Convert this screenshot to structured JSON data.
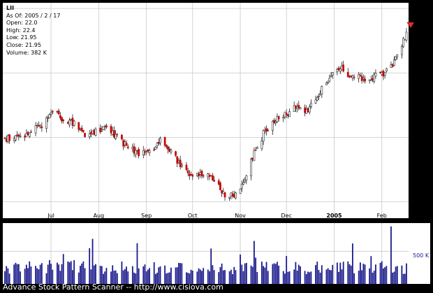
{
  "info": {
    "ticker": "LII",
    "as_of": "As Of: 2005 / 2 / 17",
    "open": "Open: 22.0",
    "high": "High: 22.4",
    "low": "Low: 21.95",
    "close": "Close: 21.95",
    "volume": "Volume: 382 K"
  },
  "caption": "Advance Stock Pattern Scanner -- http://www.cisiova.com",
  "colors": {
    "up": "#000000",
    "down": "#cc0000",
    "volume": "#1a1a8c",
    "grid": "#c8c8c8",
    "marker": "#e03030"
  },
  "chart_data": {
    "type": "candlestick",
    "title": "LII",
    "y_ticks": [
      "14",
      "17",
      "20",
      "23"
    ],
    "ylim": [
      13.3,
      23.2
    ],
    "x_ticks": [
      "Jul",
      "Aug",
      "Sep",
      "Oct",
      "Nov",
      "Dec",
      "2005",
      "Feb"
    ],
    "volume_label": "500 K",
    "anchors": [
      [
        "2004-06-01",
        16.9
      ],
      [
        "2004-06-10",
        17.0
      ],
      [
        "2004-06-18",
        17.2
      ],
      [
        "2004-06-25",
        17.6
      ],
      [
        "2004-07-01",
        18.3
      ],
      [
        "2004-07-08",
        17.9
      ],
      [
        "2004-07-16",
        17.6
      ],
      [
        "2004-07-23",
        17.2
      ],
      [
        "2004-07-30",
        17.3
      ],
      [
        "2004-08-06",
        17.6
      ],
      [
        "2004-08-13",
        17.0
      ],
      [
        "2004-08-20",
        16.5
      ],
      [
        "2004-08-27",
        16.2
      ],
      [
        "2004-09-03",
        16.3
      ],
      [
        "2004-09-10",
        16.8
      ],
      [
        "2004-09-17",
        16.3
      ],
      [
        "2004-09-24",
        15.6
      ],
      [
        "2004-10-01",
        15.1
      ],
      [
        "2004-10-08",
        15.3
      ],
      [
        "2004-10-15",
        15.0
      ],
      [
        "2004-10-22",
        14.2
      ],
      [
        "2004-10-29",
        14.3
      ],
      [
        "2004-11-03",
        14.9
      ],
      [
        "2004-11-10",
        16.3
      ],
      [
        "2004-11-17",
        17.3
      ],
      [
        "2004-11-24",
        17.8
      ],
      [
        "2004-12-01",
        18.1
      ],
      [
        "2004-12-08",
        18.5
      ],
      [
        "2004-12-15",
        18.2
      ],
      [
        "2004-12-22",
        19.0
      ],
      [
        "2004-12-29",
        19.8
      ],
      [
        "2005-01-05",
        20.2
      ],
      [
        "2005-01-12",
        19.9
      ],
      [
        "2005-01-19",
        19.7
      ],
      [
        "2005-01-26",
        19.8
      ],
      [
        "2005-02-02",
        19.9
      ],
      [
        "2005-02-09",
        20.5
      ],
      [
        "2005-02-14",
        21.2
      ],
      [
        "2005-02-17",
        21.95
      ]
    ],
    "volume_ylim": [
      0,
      900
    ]
  }
}
